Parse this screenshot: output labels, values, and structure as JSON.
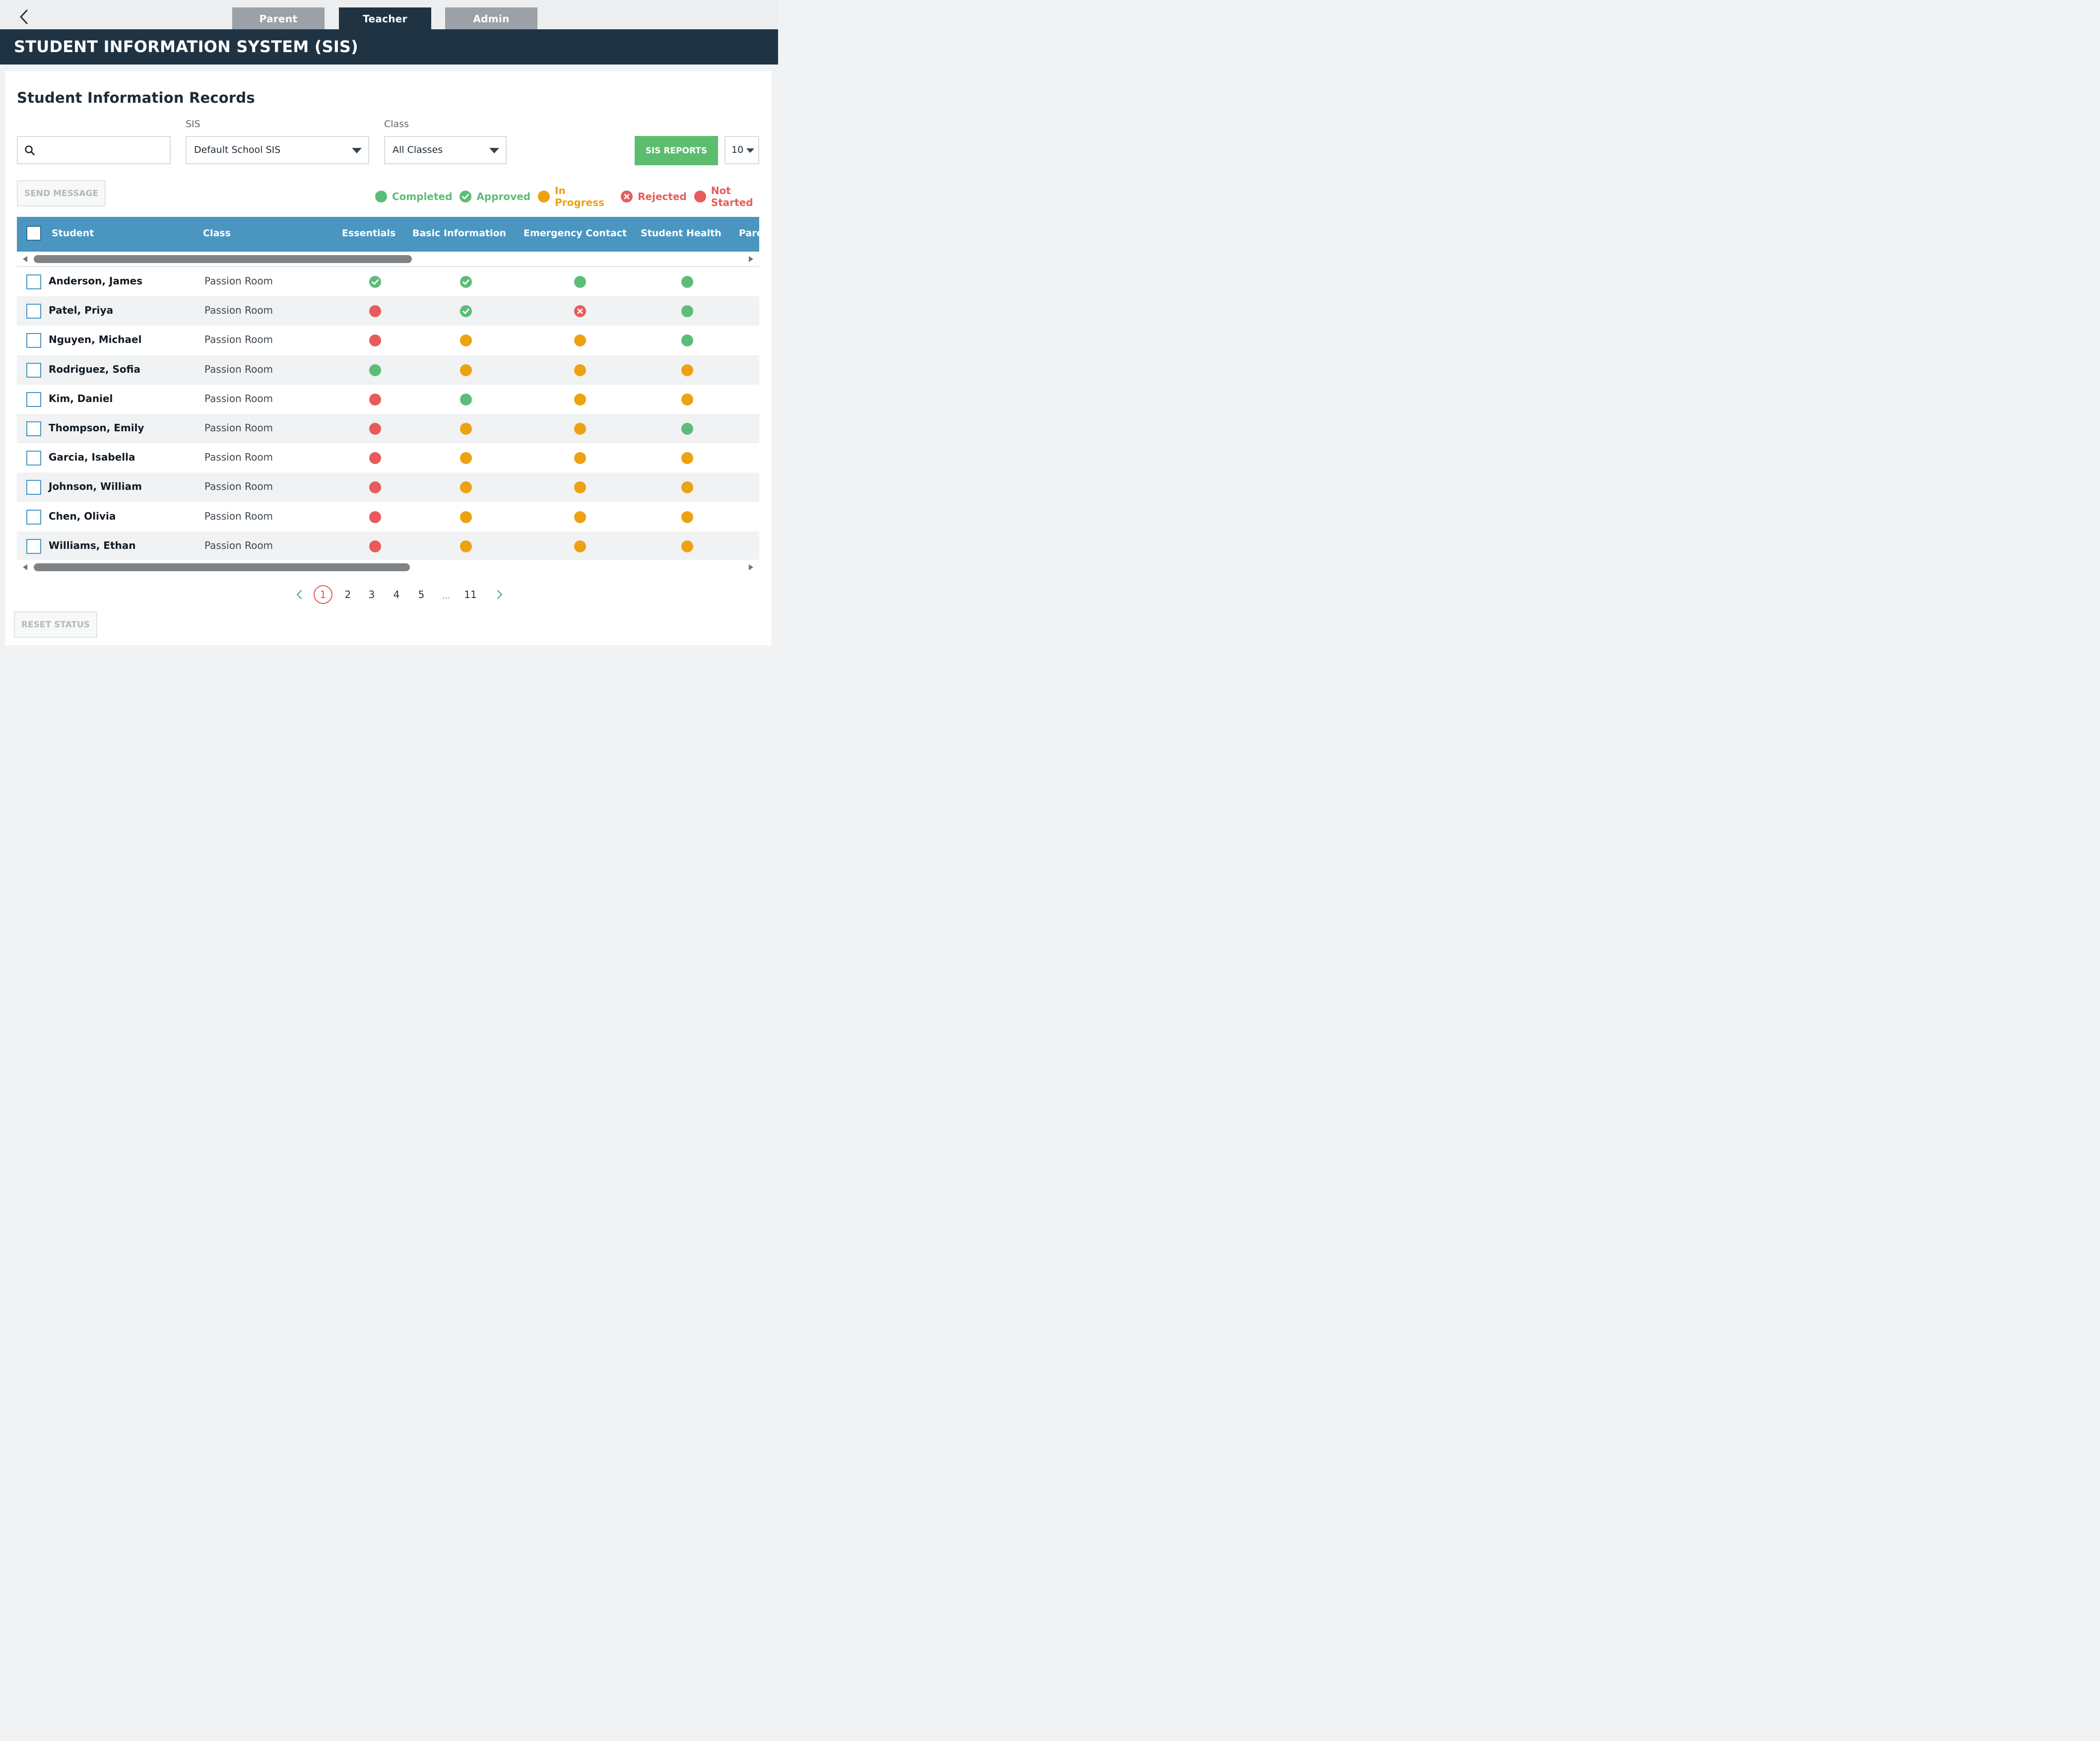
{
  "tabs": [
    {
      "label": "Parent",
      "active": false
    },
    {
      "label": "Teacher",
      "active": true
    },
    {
      "label": "Admin",
      "active": false
    }
  ],
  "header": {
    "title": "STUDENT INFORMATION SYSTEM (SIS)"
  },
  "records": {
    "title": "Student Information Records"
  },
  "filters": {
    "search": {
      "value": "",
      "placeholder": ""
    },
    "sis": {
      "label": "SIS",
      "value": "Default School SIS"
    },
    "class": {
      "label": "Class",
      "value": "All Classes"
    }
  },
  "actions": {
    "reports_label": "SIS REPORTS",
    "per_page": "10",
    "send_message_label": "SEND MESSAGE",
    "reset_status_label": "RESET STATUS"
  },
  "legend": [
    {
      "key": "completed",
      "label": "Completed"
    },
    {
      "key": "approved",
      "label": "Approved"
    },
    {
      "key": "in_progress",
      "label": "In Progress"
    },
    {
      "key": "rejected",
      "label": "Rejected"
    },
    {
      "key": "not_started",
      "label": "Not Started"
    }
  ],
  "status_colors": {
    "completed": "#5cbd79",
    "approved": "#5cbd79",
    "in_progress": "#eda212",
    "rejected": "#e85b5c",
    "not_started": "#e85b5c"
  },
  "table": {
    "columns": [
      "Student",
      "Class",
      "Essentials",
      "Basic Information",
      "Emergency Contact",
      "Student Health",
      "Pare"
    ],
    "rows": [
      {
        "name": "Anderson, James",
        "class": "Passion Room",
        "status": [
          "approved",
          "approved",
          "completed",
          "completed"
        ]
      },
      {
        "name": "Patel, Priya",
        "class": "Passion Room",
        "status": [
          "not_started",
          "approved",
          "rejected",
          "completed"
        ]
      },
      {
        "name": "Nguyen, Michael",
        "class": "Passion Room",
        "status": [
          "not_started",
          "in_progress",
          "in_progress",
          "completed"
        ]
      },
      {
        "name": "Rodriguez, Sofia",
        "class": "Passion Room",
        "status": [
          "completed",
          "in_progress",
          "in_progress",
          "in_progress"
        ]
      },
      {
        "name": "Kim, Daniel",
        "class": "Passion Room",
        "status": [
          "not_started",
          "completed",
          "in_progress",
          "in_progress"
        ]
      },
      {
        "name": "Thompson, Emily",
        "class": "Passion Room",
        "status": [
          "not_started",
          "in_progress",
          "in_progress",
          "completed"
        ]
      },
      {
        "name": "Garcia, Isabella",
        "class": "Passion Room",
        "status": [
          "not_started",
          "in_progress",
          "in_progress",
          "in_progress"
        ]
      },
      {
        "name": "Johnson, William",
        "class": "Passion Room",
        "status": [
          "not_started",
          "in_progress",
          "in_progress",
          "in_progress"
        ]
      },
      {
        "name": "Chen, Olivia",
        "class": "Passion Room",
        "status": [
          "not_started",
          "in_progress",
          "in_progress",
          "in_progress"
        ]
      },
      {
        "name": "Williams, Ethan",
        "class": "Passion Room",
        "status": [
          "not_started",
          "in_progress",
          "in_progress",
          "in_progress"
        ]
      }
    ]
  },
  "pagination": {
    "current": "1",
    "pages": [
      "1",
      "2",
      "3",
      "4",
      "5"
    ],
    "ellipsis": "...",
    "last": "11"
  },
  "icons": {
    "back": "chevron-left-icon",
    "search": "search-icon",
    "prev": "chevron-left-icon",
    "next": "chevron-right-icon"
  }
}
